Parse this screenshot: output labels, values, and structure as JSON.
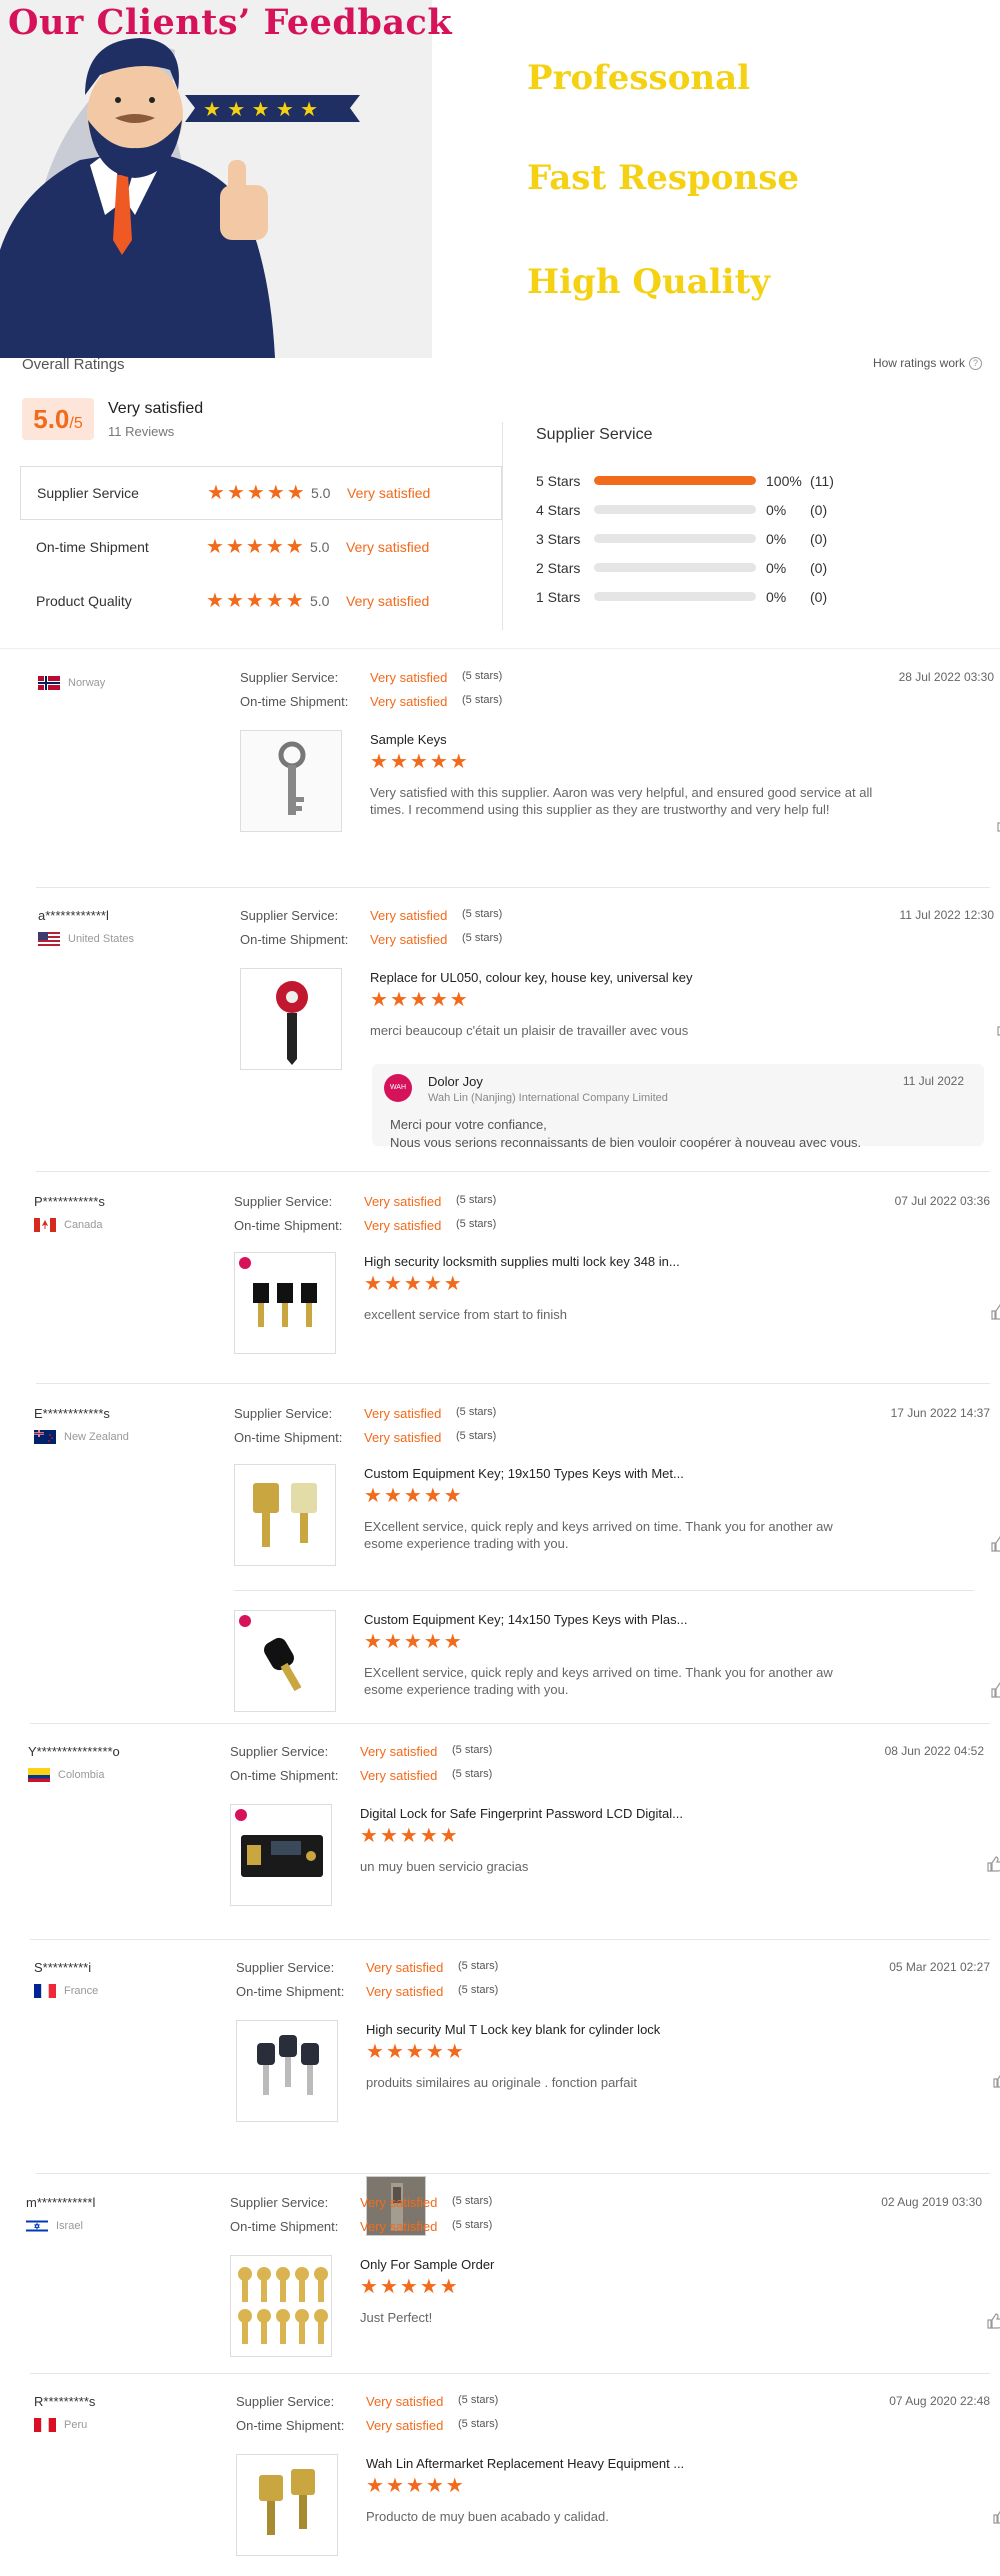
{
  "banner": {
    "title": "Our Clients’ Feedback",
    "slogans": [
      "Professonal",
      "Fast Response",
      "High Quality"
    ]
  },
  "overall": {
    "title": "Overall Ratings",
    "how_ratings": "How ratings work",
    "score": "5.0",
    "score_of": "/5",
    "score_label": "Very satisfied",
    "reviews_count": "11 Reviews",
    "metrics": [
      {
        "name": "Supplier Service",
        "value": "5.0",
        "label": "Very satisfied",
        "stars": 5
      },
      {
        "name": "On-time Shipment",
        "value": "5.0",
        "label": "Very satisfied",
        "stars": 5
      },
      {
        "name": "Product Quality",
        "value": "5.0",
        "label": "Very satisfied",
        "stars": 5
      }
    ],
    "distribution_title": "Supplier Service",
    "distribution": [
      {
        "label": "5 Stars",
        "fraction": 1.0,
        "pct": "100%",
        "count": "(11)"
      },
      {
        "label": "4 Stars",
        "fraction": 0,
        "pct": "0%",
        "count": "(0)"
      },
      {
        "label": "3 Stars",
        "fraction": 0,
        "pct": "0%",
        "count": "(0)"
      },
      {
        "label": "2 Stars",
        "fraction": 0,
        "pct": "0%",
        "count": "(0)"
      },
      {
        "label": "1 Stars",
        "fraction": 0,
        "pct": "0%",
        "count": "(0)"
      }
    ]
  },
  "labels": {
    "supplier_service": "Supplier Service:",
    "ontime_shipment": "On-time Shipment:",
    "very_satisfied": "Very satisfied",
    "five_stars": "(5 stars)"
  },
  "reviews": [
    {
      "user": "",
      "country": "Norway",
      "date": "28 Jul 2022 03:30",
      "products": [
        {
          "title": "Sample Keys",
          "text": "Very satisfied with this supplier. Aaron was very helpful, and ensured good service at all times. I recommend using this supplier as they are trustworthy and very help ful!",
          "likes": "0"
        }
      ]
    },
    {
      "user": "a************l",
      "country": "United States",
      "date": "11 Jul 2022 12:30",
      "products": [
        {
          "title": "Replace for UL050, colour key, house key, universal key",
          "text": "merci beaucoup c'était un plaisir de travailler avec vous",
          "likes": "0"
        }
      ],
      "reply": {
        "name": "Dolor Joy",
        "company": "Wah Lin (Nanjing) International Company Limited",
        "date": "11 Jul 2022",
        "text1": "Merci pour votre confiance,",
        "text2": "Nous vous serions reconnaissants de bien vouloir coopérer à nouveau avec vous."
      }
    },
    {
      "user": "P***********s",
      "country": "Canada",
      "date": "07 Jul 2022 03:36",
      "products": [
        {
          "title": "High security locksmith supplies multi lock key 348 in...",
          "text": "excellent service from start to finish",
          "likes": "0"
        }
      ]
    },
    {
      "user": "E************s",
      "country": "New Zealand",
      "date": "17 Jun 2022 14:37",
      "products": [
        {
          "title": "Custom Equipment Key; 19x150 Types Keys with Met...",
          "text": "EXcellent service, quick reply and keys arrived on time.  Thank you for another aw esome experience trading with you.",
          "likes": "0"
        },
        {
          "title": "Custom Equipment Key; 14x150 Types Keys with Plas...",
          "text": "EXcellent service, quick reply and keys arrived on time.  Thank you for another aw esome experience trading with you.",
          "likes": "0"
        }
      ]
    },
    {
      "user": "Y***************o",
      "country": "Colombia",
      "date": "08 Jun 2022 04:52",
      "products": [
        {
          "title": "Digital Lock for Safe Fingerprint Password LCD Digital...",
          "text": "un muy buen servicio gracias",
          "likes": "0"
        }
      ]
    },
    {
      "user": "S*********i",
      "country": "France",
      "date": "05 Mar 2021 02:27",
      "products": [
        {
          "title": "High security Mul T Lock key blank for cylinder lock",
          "text": "produits similaires au originale . fonction parfait",
          "likes": "0"
        }
      ]
    },
    {
      "user": "m***********l",
      "country": "Israel",
      "date": "02 Aug 2019 03:30",
      "products": [
        {
          "title": "Only For Sample Order",
          "text": "Just Perfect!",
          "likes": "0"
        }
      ]
    },
    {
      "user": "R*********s",
      "country": "Peru",
      "date": "07 Aug 2020 22:48",
      "products": [
        {
          "title": "Wah Lin Aftermarket Replacement Heavy Equipment ...",
          "text": "Producto de muy buen acabado y calidad.",
          "likes": "0"
        }
      ]
    }
  ],
  "colors": {
    "accent": "#f26a1b",
    "banner_title": "#d6135a",
    "slogan": "#f4d112"
  }
}
